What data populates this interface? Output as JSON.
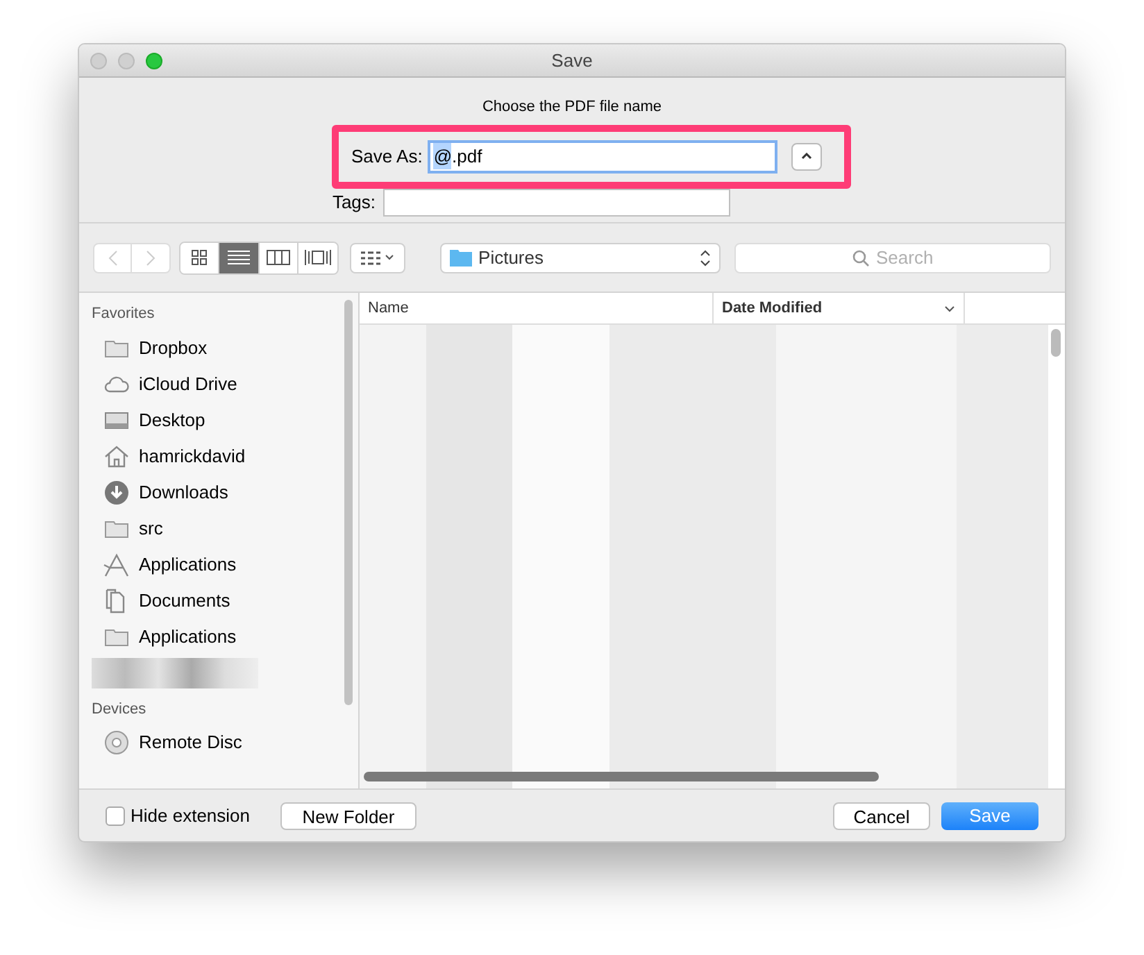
{
  "window": {
    "title": "Save"
  },
  "prompt": "Choose the PDF file name",
  "save_as": {
    "label": "Save As:",
    "value": "@.pdf",
    "highlighted": true
  },
  "tags": {
    "label": "Tags:"
  },
  "view_modes": [
    {
      "kind": "icons",
      "selected": false
    },
    {
      "kind": "list",
      "selected": true
    },
    {
      "kind": "columns",
      "selected": false
    },
    {
      "kind": "coverflow",
      "selected": false
    }
  ],
  "location": "Pictures",
  "search": {
    "placeholder": "Search"
  },
  "sidebar": {
    "sections": [
      {
        "title": "Favorites",
        "items": [
          {
            "label": "Dropbox",
            "kind": "folder"
          },
          {
            "label": "iCloud Drive",
            "kind": "cloud"
          },
          {
            "label": "Desktop",
            "kind": "desktop"
          },
          {
            "label": "hamrickdavid",
            "kind": "home"
          },
          {
            "label": "Downloads",
            "kind": "download"
          },
          {
            "label": "src",
            "kind": "folder"
          },
          {
            "label": "Applications",
            "kind": "apps"
          },
          {
            "label": "Documents",
            "kind": "documents"
          },
          {
            "label": "Applications",
            "kind": "folder"
          },
          {
            "kind": "blurred"
          }
        ]
      },
      {
        "title": "Devices",
        "items": [
          {
            "label": "Remote Disc",
            "kind": "disc"
          }
        ]
      }
    ]
  },
  "table": {
    "columns": [
      {
        "label": "Name",
        "sorted": false
      },
      {
        "label": "Date Modified",
        "sorted": true
      }
    ]
  },
  "footer": {
    "hide_extension": {
      "label": "Hide extension",
      "checked": false
    },
    "new_folder": "New Folder",
    "cancel": "Cancel",
    "save": "Save"
  }
}
